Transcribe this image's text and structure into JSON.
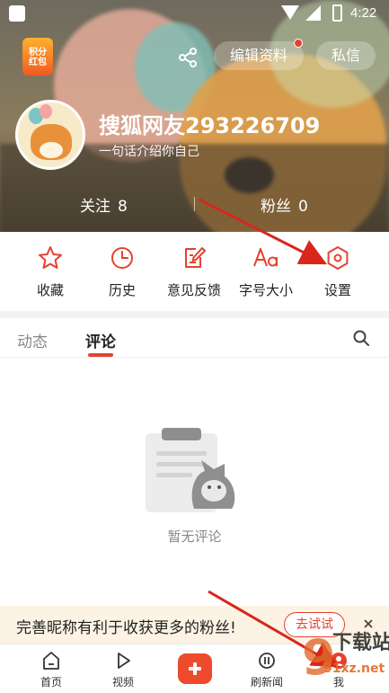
{
  "statusbar": {
    "time": "4:22"
  },
  "header": {
    "points_badge": "积分红包",
    "edit_profile_label": "编辑资料",
    "messages_label": "私信",
    "share_icon": "share-icon"
  },
  "profile": {
    "username": "搜狐网友293226709",
    "bio": "一句话介绍你自己",
    "following_label": "关注",
    "following_count": "8",
    "fans_label": "粉丝",
    "fans_count": "0"
  },
  "menu": [
    {
      "label": "收藏",
      "icon": "star-icon"
    },
    {
      "label": "历史",
      "icon": "clock-icon"
    },
    {
      "label": "意见反馈",
      "icon": "feedback-icon"
    },
    {
      "label": "字号大小",
      "icon": "font-size-icon"
    },
    {
      "label": "设置",
      "icon": "settings-icon"
    }
  ],
  "tabs": [
    {
      "label": "动态"
    },
    {
      "label": "评论"
    }
  ],
  "empty_state": {
    "text": "暂无评论"
  },
  "banner": {
    "text": "完善昵称有利于收获更多的粉丝!",
    "action_label": "去试试"
  },
  "bottom_nav": [
    {
      "label": "首页",
      "icon": "home-icon"
    },
    {
      "label": "视频",
      "icon": "play-icon"
    },
    {
      "label": "",
      "icon": "plus-icon"
    },
    {
      "label": "刷新闻",
      "icon": "news-icon"
    },
    {
      "label": "我",
      "icon": "profile-icon"
    }
  ],
  "watermark": {
    "text": "下载站",
    "subtext": "91xz.net"
  },
  "colors": {
    "accent": "#e5422f",
    "banner_bg": "#fdf3e5",
    "divider": "#f3f3f3"
  }
}
